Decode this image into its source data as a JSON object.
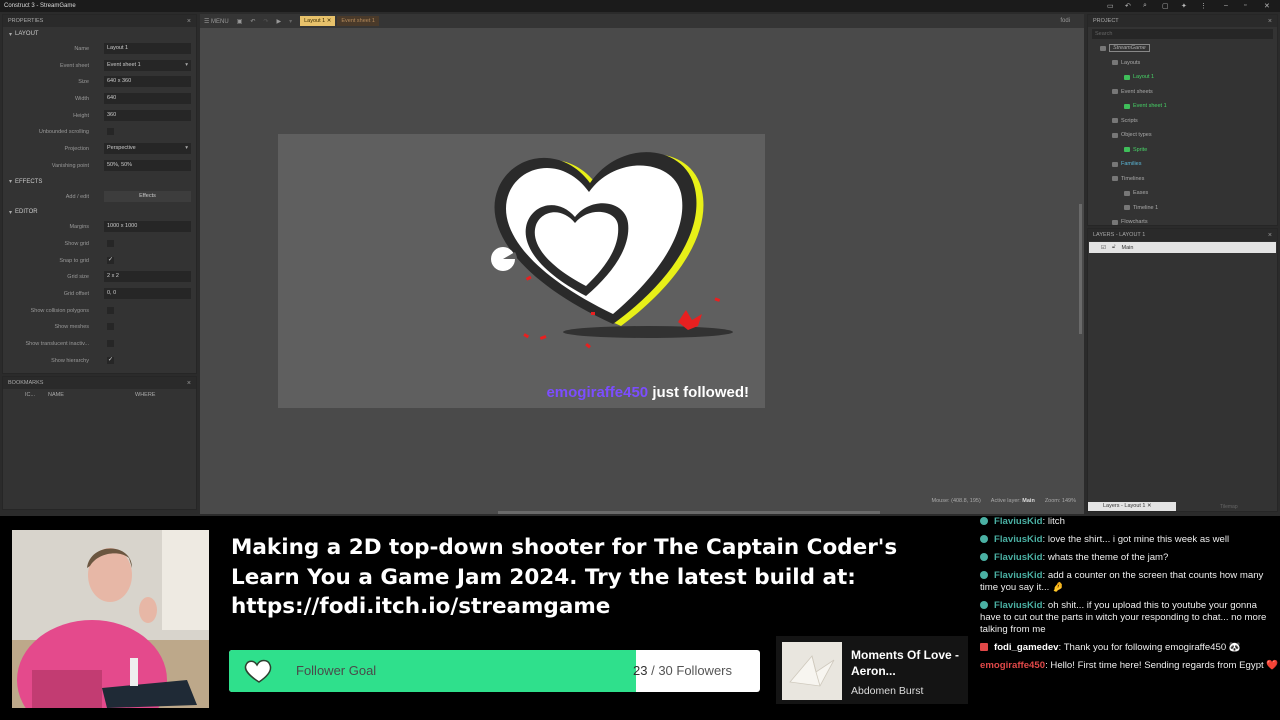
{
  "window": {
    "title": "Construct 3 - StreamGame"
  },
  "properties": {
    "header": "PROPERTIES",
    "sections": {
      "layout": "LAYOUT",
      "effects": "EFFECTS",
      "editor": "EDITOR"
    },
    "rows": [
      {
        "label": "Name",
        "value": "Layout 1",
        "kind": "text"
      },
      {
        "label": "Event sheet",
        "value": "Event sheet 1",
        "kind": "select"
      },
      {
        "label": "Size",
        "value": "640 x 360",
        "kind": "text"
      },
      {
        "label": "Width",
        "value": "640",
        "kind": "text"
      },
      {
        "label": "Height",
        "value": "360",
        "kind": "text"
      },
      {
        "label": "Unbounded scrolling",
        "value": "",
        "kind": "check"
      },
      {
        "label": "Projection",
        "value": "Perspective",
        "kind": "select"
      },
      {
        "label": "Vanishing point",
        "value": "50%, 50%",
        "kind": "text"
      }
    ],
    "effects_row": {
      "label": "Add / edit",
      "value": "Effects"
    },
    "editor_rows": [
      {
        "label": "Margins",
        "value": "1000 x 1000",
        "kind": "text"
      },
      {
        "label": "Show grid",
        "value": "",
        "kind": "check"
      },
      {
        "label": "Snap to grid",
        "value": "✓",
        "kind": "check"
      },
      {
        "label": "Grid size",
        "value": "2 x 2",
        "kind": "text"
      },
      {
        "label": "Grid offset",
        "value": "0, 0",
        "kind": "text"
      },
      {
        "label": "Show collision polygons",
        "value": "",
        "kind": "check"
      },
      {
        "label": "Show meshes",
        "value": "",
        "kind": "check"
      },
      {
        "label": "Show translucent inactiv...",
        "value": "",
        "kind": "check"
      },
      {
        "label": "Show hierarchy",
        "value": "✓",
        "kind": "check"
      }
    ]
  },
  "bookmarks": {
    "header": "BOOKMARKS",
    "cols": [
      "IC...",
      "NAME",
      "WHERE"
    ]
  },
  "toolbar": {
    "menu": "MENU",
    "tabs": [
      "Layout 1",
      "Event sheet 1"
    ],
    "user": "fodi"
  },
  "stage": {
    "follower_name": "emogiraffe450",
    "follow_text": "just followed!"
  },
  "status": {
    "mouse": "Mouse: (408.8, 195)",
    "layer_label": "Active layer:",
    "layer": "Main",
    "zoom": "Zoom: 149%"
  },
  "project": {
    "header": "PROJECT",
    "search": "Search",
    "items": [
      {
        "label": "StreamGame",
        "depth": 0,
        "hl": true
      },
      {
        "label": "Layouts",
        "depth": 1
      },
      {
        "label": "Layout 1",
        "depth": 2,
        "green": true
      },
      {
        "label": "Event sheets",
        "depth": 1
      },
      {
        "label": "Event sheet 1",
        "depth": 2,
        "green": true
      },
      {
        "label": "Scripts",
        "depth": 1
      },
      {
        "label": "Object types",
        "depth": 1
      },
      {
        "label": "Sprite",
        "depth": 2,
        "green": true
      },
      {
        "label": "Families",
        "depth": 1,
        "cyan": true
      },
      {
        "label": "Timelines",
        "depth": 1
      },
      {
        "label": "Eases",
        "depth": 2
      },
      {
        "label": "Timeline 1",
        "depth": 2
      },
      {
        "label": "Flowcharts",
        "depth": 1
      }
    ]
  },
  "layers": {
    "header": "LAYERS - LAYOUT 1",
    "items": [
      "Main"
    ],
    "bottom_tab": "Layers - Layout 1",
    "hidden_tab": "Tilemap"
  },
  "stream": {
    "description": "Making a 2D top-down shooter for The Captain Coder's Learn You a Game Jam 2024. Try the latest build at: https://fodi.itch.io/streamgame"
  },
  "goal": {
    "label": "Follower Goal",
    "current": "23",
    "sep": " / ",
    "target": "30 Followers",
    "progress": 0.767,
    "color": "#2fe08c"
  },
  "song": {
    "title": "Moments Of Love - Aeron...",
    "artist": "Abdomen Burst"
  },
  "chat": [
    {
      "user": "FlaviusKid",
      "text": "litch",
      "badge": true
    },
    {
      "user": "FlaviusKid",
      "text": "love the shirt... i got mine this week as well",
      "badge": true
    },
    {
      "user": "FlaviusKid",
      "text": "whats the theme of the jam?",
      "badge": true
    },
    {
      "user": "FlaviusKid",
      "text": "add a counter on the screen that counts how many time you say it... 🤌",
      "badge": true
    },
    {
      "user": "FlaviusKid",
      "text": "oh shit... if you upload this to youtube your gonna have to cut out the parts in witch your responding to chat... no more talking from me",
      "badge": true
    },
    {
      "user": "fodi_gamedev",
      "text": "Thank you for following emogiraffe450 🐼",
      "badge": false,
      "color": "#ffffff",
      "red": true
    },
    {
      "user": "emogiraffe450",
      "text": "Hello! First time here! Sending regards from Egypt ❤️",
      "badge": false,
      "color": "#e04848"
    }
  ],
  "colors": {
    "follower": "#7c4dff",
    "accent_green": "#2fe08c",
    "tab_active": "#e8c26b",
    "chat_name": "#4ab0a3",
    "heart_accent": "#e8f018",
    "splash": "#e82020"
  }
}
